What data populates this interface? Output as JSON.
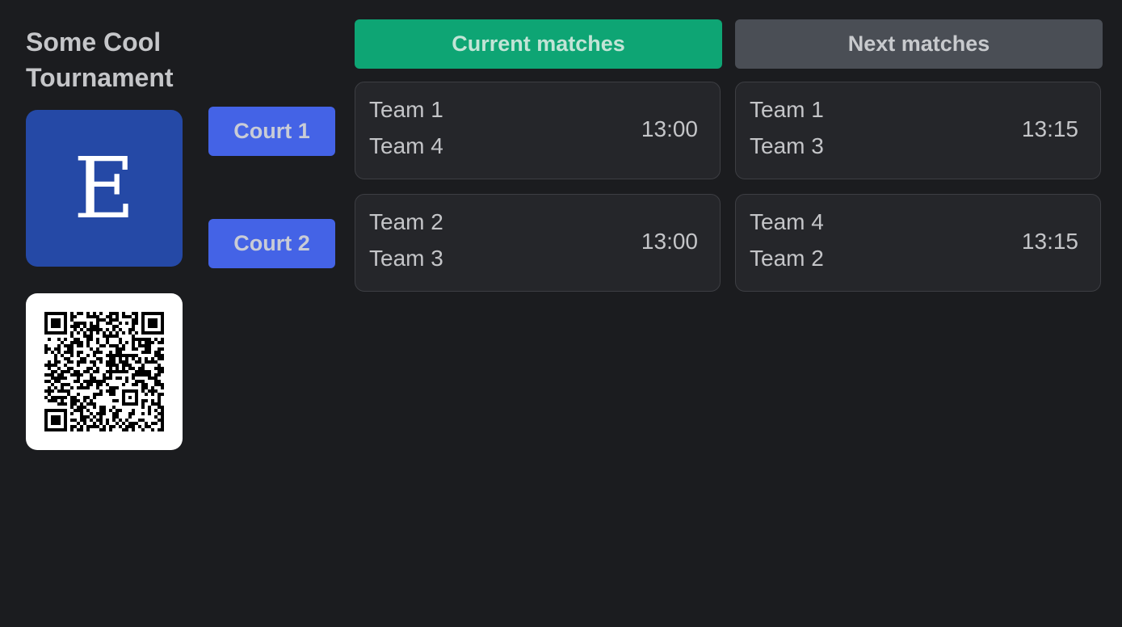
{
  "tournament": {
    "title": "Some Cool Tournament",
    "logo_letter": "E",
    "logo_color": "#2549a6",
    "qr_code": "qr-code-icon"
  },
  "tabs": {
    "current": "Current matches",
    "next": "Next matches"
  },
  "colors": {
    "background": "#1b1c1f",
    "court_button": "#4463e6",
    "current_tab": "#0ea574",
    "next_tab": "#4a4e55",
    "card": "#25262a"
  },
  "courts": [
    {
      "label": "Court 1",
      "current": {
        "team1": "Team 1",
        "team2": "Team 4",
        "time": "13:00"
      },
      "next": {
        "team1": "Team 1",
        "team2": "Team 3",
        "time": "13:15"
      }
    },
    {
      "label": "Court 2",
      "current": {
        "team1": "Team 2",
        "team2": "Team 3",
        "time": "13:00"
      },
      "next": {
        "team1": "Team 4",
        "team2": "Team 2",
        "time": "13:15"
      }
    }
  ]
}
